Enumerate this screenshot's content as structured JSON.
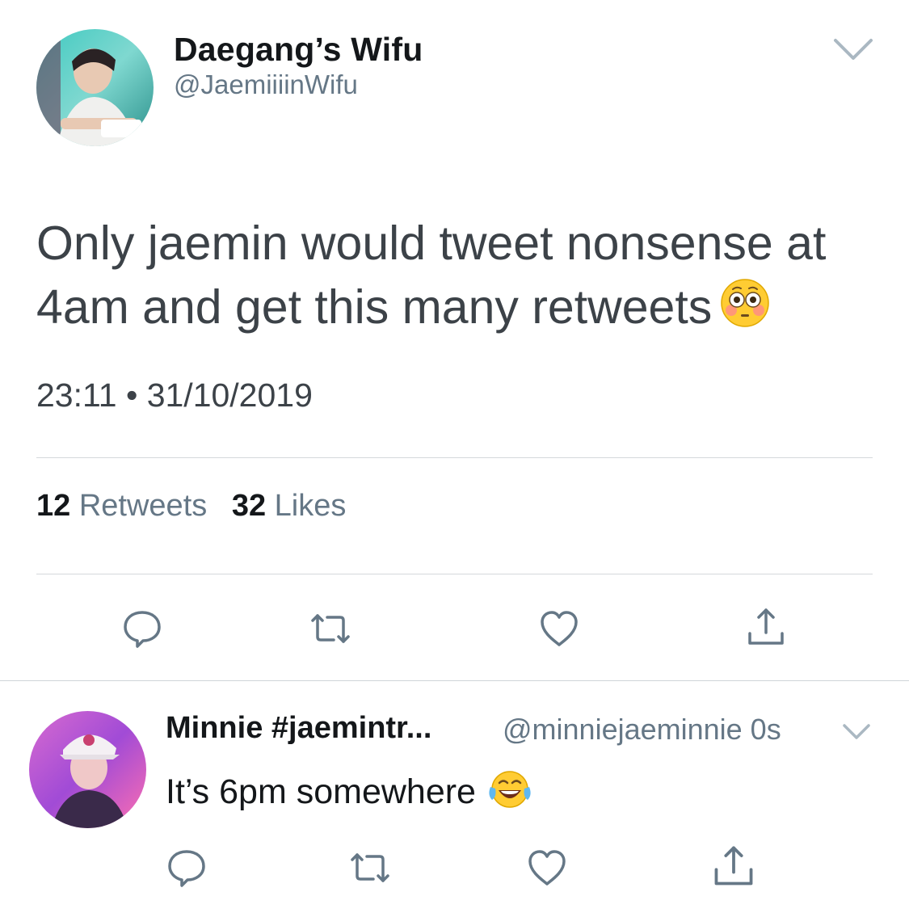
{
  "tweet": {
    "display_name": "Daegang’s Wifu",
    "handle": "@JaemiiiinWifu",
    "text": "Only jaemin would tweet nonsense at 4am and get this many retweets",
    "emoji": "flushed-face-emoji",
    "timestamp": "23:11 • 31/10/2019",
    "retweets_count": "12",
    "retweets_label": "Retweets",
    "likes_count": "32",
    "likes_label": "Likes",
    "avatar": "profile-photo"
  },
  "reply": {
    "display_name": "Minnie #jaemintr...",
    "meta": "@minniejaeminnie 0s",
    "text": "It’s 6pm somewhere",
    "emoji": "tears-of-joy-emoji",
    "avatar": "profile-photo"
  },
  "icons": [
    "reply-icon",
    "retweet-icon",
    "like-icon",
    "share-icon",
    "chevron-down-icon"
  ],
  "colors": {
    "text_primary": "#14171a",
    "text_secondary": "#657786",
    "divider": "#d5d9dc",
    "icon": "#657786"
  }
}
